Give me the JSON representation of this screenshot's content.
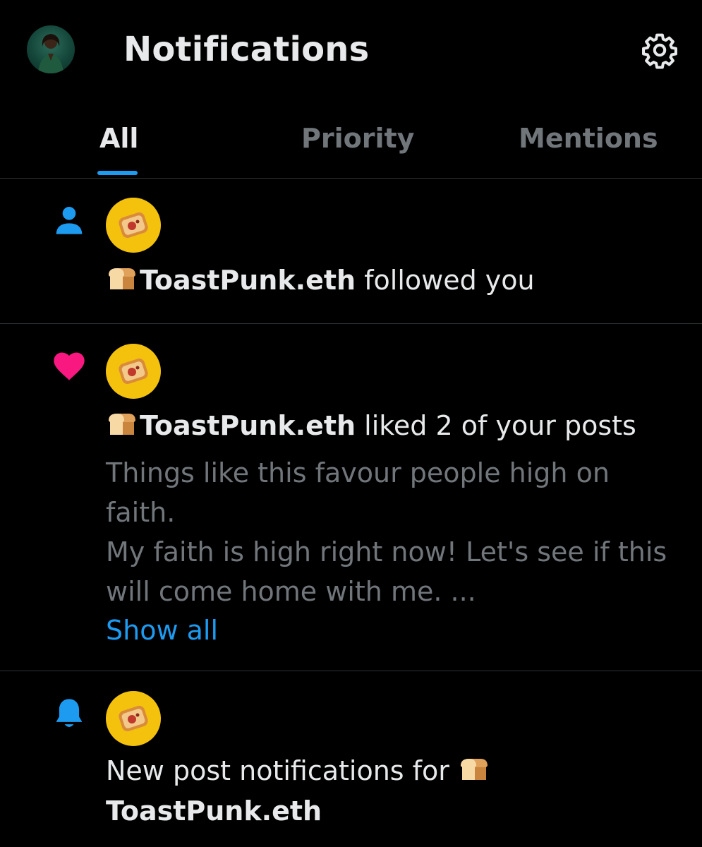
{
  "header": {
    "title": "Notifications",
    "settings_icon": "gear-icon"
  },
  "tabs": [
    {
      "label": "All",
      "active": true
    },
    {
      "label": "Priority",
      "active": false
    },
    {
      "label": "Mentions",
      "active": false
    }
  ],
  "colors": {
    "background": "#000000",
    "accent": "#1d9bf0",
    "like": "#f91880",
    "muted": "#71767b",
    "text": "#e7e9ea",
    "divider": "#2f3336"
  },
  "notifications": [
    {
      "type_icon": "person-icon",
      "user": "ToastPunk.eth",
      "action": "followed you"
    },
    {
      "type_icon": "heart-icon",
      "user": "ToastPunk.eth",
      "action": "liked 2 of your posts",
      "preview_line1": "Things like this favour people high on",
      "preview_line2": "faith.",
      "preview_line3": "My faith is high right now! Let's see if this",
      "preview_line4": "will come home with me. ...",
      "show_all": "Show all"
    },
    {
      "type_icon": "bell-icon",
      "text": "New post notifications for",
      "user": "ToastPunk.eth"
    }
  ]
}
